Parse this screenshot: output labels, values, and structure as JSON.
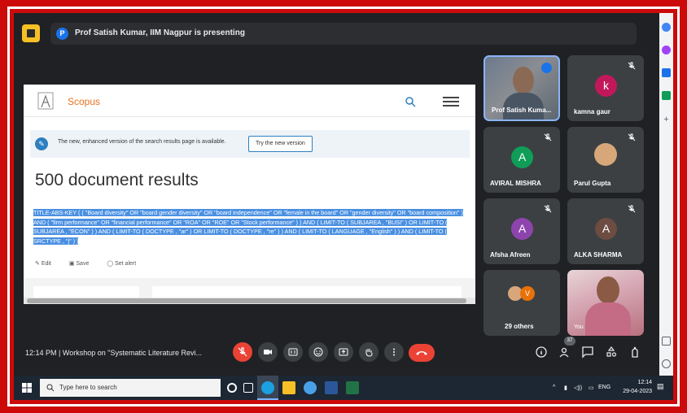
{
  "meet": {
    "presenting_initial": "P",
    "presenting_text": "Prof Satish Kumar, IIM Nagpur is presenting",
    "time": "12:14 PM",
    "separator": "|",
    "meeting_title": "Workshop on \"Systematic Literature Revi...",
    "people_count": "37",
    "participants": [
      {
        "name": "Prof Satish Kuma...",
        "type": "video"
      },
      {
        "name": "kamna gaur",
        "initial": "k",
        "color": "#c2185b"
      },
      {
        "name": "AVIRAL MISHRA",
        "initial": "A",
        "color": "#0f9d58"
      },
      {
        "name": "Parul Gupta",
        "type": "photo"
      },
      {
        "name": "Afsha Afreen",
        "initial": "A",
        "color": "#8e44ad"
      },
      {
        "name": "ALKA SHARMA",
        "initial": "A",
        "color": "#6d4c41"
      },
      {
        "name": "29 others",
        "initial": "V",
        "color": "#e8710a"
      },
      {
        "name": "You",
        "type": "video"
      }
    ]
  },
  "scopus": {
    "brand": "Scopus",
    "banner_text": "The new, enhanced version of the search results page is available.",
    "banner_button": "Try the new version",
    "results_title": "500 document results",
    "query": "TITLE-ABS-KEY ( ( \"Board diversity\" OR \"board gender diversity\" OR \"board independence\" OR \"female in the board\" OR \"gender diversity\" OR \"board composition\" ) AND ( \"firm performance\" OR \"financial performance\" OR \"ROA\" OR \"ROE\" OR \"Stock performance\" ) ) AND ( LIMIT-TO ( SUBJAREA , \"BUSI\" ) OR LIMIT-TO ( SUBJAREA , \"ECON\" ) ) AND ( LIMIT-TO ( DOCTYPE , \"ar\" ) OR LIMIT-TO ( DOCTYPE , \"re\" ) ) AND ( LIMIT-TO ( LANGUAGE , \"English\" ) ) AND ( LIMIT-TO ( SRCTYPE , \"j\" ) )",
    "actions": [
      "Edit",
      "Save",
      "Set alert"
    ]
  },
  "taskbar": {
    "search_placeholder": "Type here to search",
    "tray_lang": "ENG",
    "clock_time": "12:14",
    "clock_date": "29-04-2023"
  },
  "colors": {
    "frame": "#cc0a0a",
    "meet_bg": "#202124",
    "tile_bg": "#3c4043",
    "end_call": "#ea4335",
    "scopus_orange": "#e9711c",
    "query_highlight": "#4a90e2"
  }
}
